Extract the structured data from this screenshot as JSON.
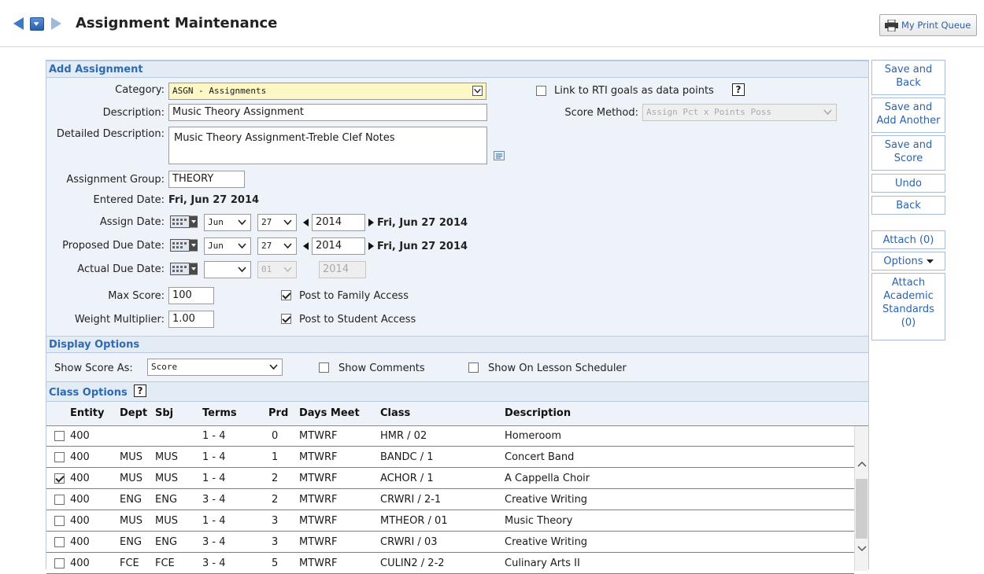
{
  "header": {
    "title": "Assignment Maintenance",
    "print_queue": "My Print Queue"
  },
  "add_assignment": {
    "section_title": "Add Assignment",
    "category_label": "Category:",
    "category_value": "ASGN - Assignments",
    "description_label": "Description:",
    "description_value": "Music Theory Assignment",
    "detailed_label": "Detailed Description:",
    "detailed_value": "Music Theory Assignment-Treble Clef Notes",
    "group_label": "Assignment Group:",
    "group_value": "THEORY",
    "entered_label": "Entered Date:",
    "entered_value": "Fri, Jun 27 2014",
    "assign_label": "Assign Date:",
    "assign_month": "Jun",
    "assign_day": "27",
    "assign_year": "2014",
    "assign_text": "Fri, Jun 27 2014",
    "proposed_label": "Proposed Due Date:",
    "proposed_month": "Jun",
    "proposed_day": "27",
    "proposed_year": "2014",
    "proposed_text": "Fri, Jun 27 2014",
    "actual_label": "Actual Due Date:",
    "actual_month": "",
    "actual_day": "01",
    "actual_year": "2014",
    "max_label": "Max Score:",
    "max_value": "100",
    "weight_label": "Weight Multiplier:",
    "weight_value": "1.00",
    "post_family": "Post to Family Access",
    "post_family_checked": true,
    "post_student": "Post to Student Access",
    "post_student_checked": true,
    "rti_label": "Link to RTI goals as data points",
    "rti_checked": false,
    "score_method_label": "Score Method:",
    "score_method_value": "Assign Pct x Points Poss"
  },
  "display_options": {
    "section_title": "Display Options",
    "show_score_label": "Show Score As:",
    "show_score_value": "Score",
    "show_comments": "Show Comments",
    "show_lesson": "Show On Lesson Scheduler"
  },
  "class_options": {
    "section_title": "Class Options",
    "columns": [
      "Entity",
      "Dept",
      "Sbj",
      "Terms",
      "Prd",
      "Days Meet",
      "Class",
      "Description"
    ],
    "rows": [
      {
        "checked": false,
        "entity": "400",
        "dept": "",
        "sbj": "",
        "terms": "1 - 4",
        "prd": "0",
        "days": "MTWRF",
        "class": "HMR / 02",
        "desc": "Homeroom"
      },
      {
        "checked": false,
        "entity": "400",
        "dept": "MUS",
        "sbj": "MUS",
        "terms": "1 - 4",
        "prd": "1",
        "days": "MTWRF",
        "class": "BANDC / 1",
        "desc": "Concert Band"
      },
      {
        "checked": true,
        "entity": "400",
        "dept": "MUS",
        "sbj": "MUS",
        "terms": "1 - 4",
        "prd": "2",
        "days": "MTWRF",
        "class": "ACHOR / 1",
        "desc": "A Cappella Choir"
      },
      {
        "checked": false,
        "entity": "400",
        "dept": "ENG",
        "sbj": "ENG",
        "terms": "3 - 4",
        "prd": "2",
        "days": "MTWRF",
        "class": "CRWRI / 2-1",
        "desc": "Creative Writing"
      },
      {
        "checked": false,
        "entity": "400",
        "dept": "MUS",
        "sbj": "MUS",
        "terms": "1 - 4",
        "prd": "3",
        "days": "MTWRF",
        "class": "MTHEOR / 01",
        "desc": "Music Theory"
      },
      {
        "checked": false,
        "entity": "400",
        "dept": "ENG",
        "sbj": "ENG",
        "terms": "3 - 4",
        "prd": "3",
        "days": "MTWRF",
        "class": "CRWRI / 03",
        "desc": "Creative Writing"
      },
      {
        "checked": false,
        "entity": "400",
        "dept": "FCE",
        "sbj": "FCE",
        "terms": "3 - 4",
        "prd": "5",
        "days": "MTWRF",
        "class": "CULIN2 / 2-2",
        "desc": "Culinary Arts II"
      }
    ]
  },
  "actions": {
    "save_back_1": "Save and",
    "save_back_2": "Back",
    "save_add_1": "Save and",
    "save_add_2": "Add Another",
    "save_score_1": "Save and",
    "save_score_2": "Score",
    "undo": "Undo",
    "back": "Back",
    "attach": "Attach (0)",
    "options": "Options",
    "standards_1": "Attach",
    "standards_2": "Academic",
    "standards_3": "Standards",
    "standards_4": "(0)"
  },
  "colors": {
    "accent": "#2e6ab1",
    "panel_bg": "#eef3f9",
    "section_bg": "#e3ebf5",
    "category_highlight": "#fdf7c6"
  }
}
